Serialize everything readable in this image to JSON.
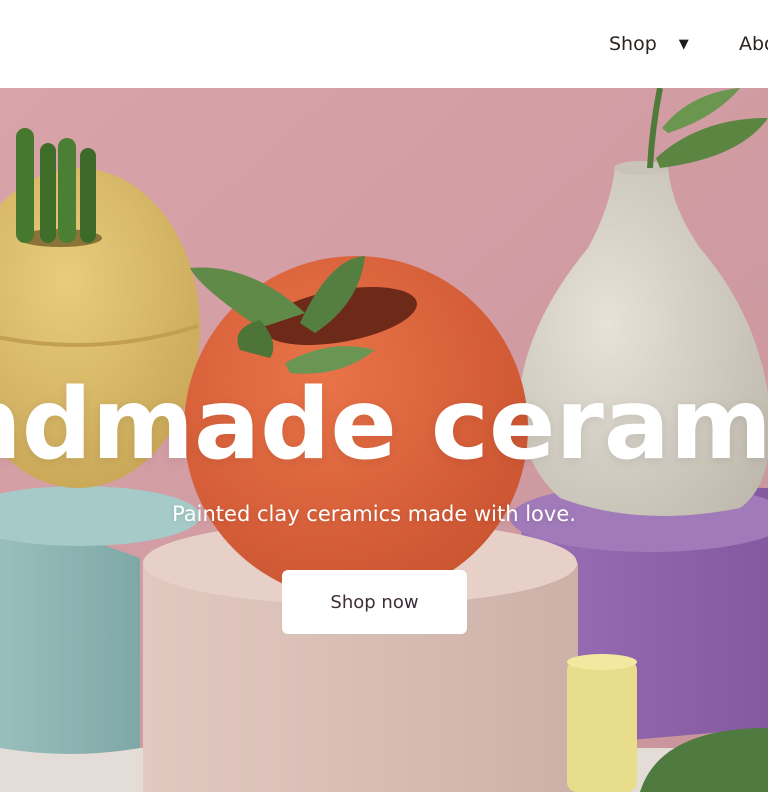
{
  "header": {
    "nav": [
      {
        "label": "Shop",
        "has_dropdown": true,
        "icon": "caret-down-icon"
      },
      {
        "label": "Abo"
      }
    ]
  },
  "hero": {
    "title": "ndmade ceram",
    "subtitle": "Painted clay ceramics made with love.",
    "cta_label": "Shop now",
    "colors": {
      "wall": "#d5a1a6",
      "yellow_pot": "#dcbf6f",
      "orange_pot": "#e0643d",
      "white_vase": "#d8d3c8",
      "teal_block": "#8fb6b4",
      "pink_block": "#d8beb5",
      "purple_block": "#8e64aa",
      "button_text": "#3e2d37"
    }
  }
}
